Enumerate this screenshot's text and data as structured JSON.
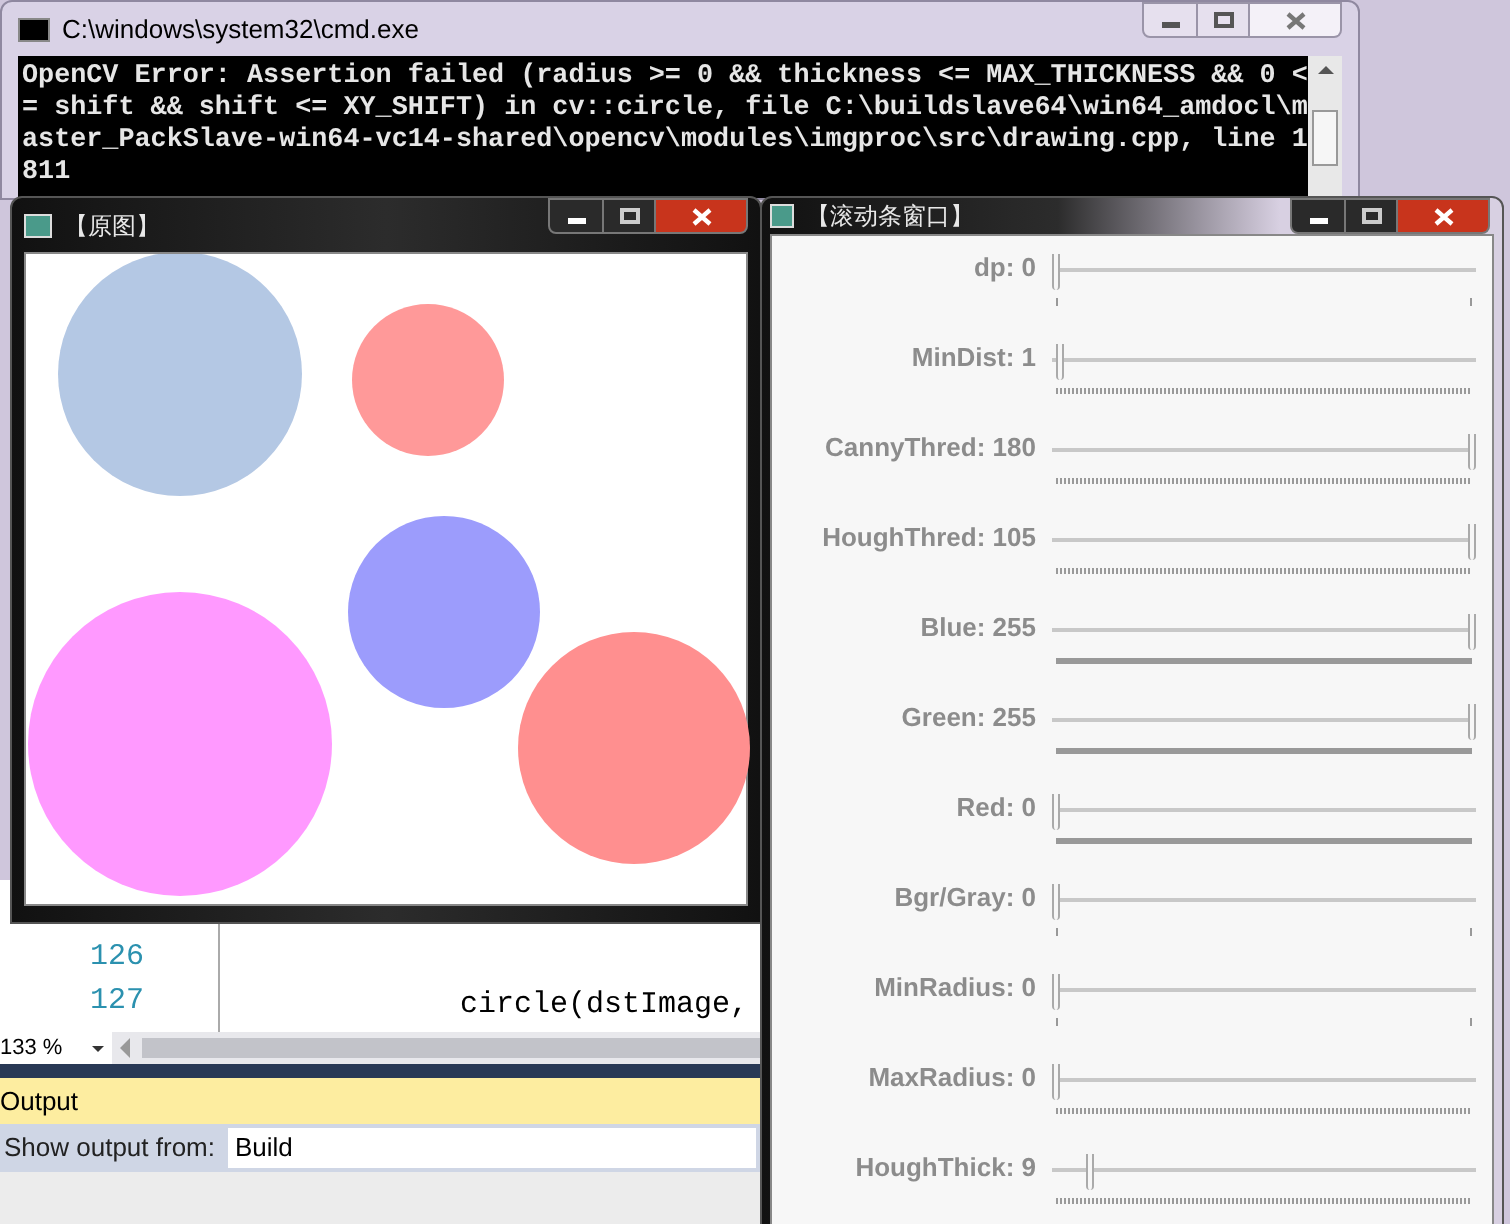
{
  "console_window": {
    "title": "C:\\windows\\system32\\cmd.exe",
    "lines": [
      "OpenCV Error: Assertion failed (radius >= 0 && thickness <= MAX_THICKNESS && 0 <",
      "= shift && shift <= XY_SHIFT) in cv::circle, file C:\\buildslave64\\win64_amdocl\\m",
      "aster_PackSlave-win64-vc14-shared\\opencv\\modules\\imgproc\\src\\drawing.cpp, line 1",
      "811"
    ]
  },
  "image_window": {
    "title": "【原图】",
    "circles": [
      {
        "color": "#b4c8e4"
      },
      {
        "color": "#ff9999"
      },
      {
        "color": "#9c9cfc"
      },
      {
        "color": "#ff99ff"
      },
      {
        "color": "#ff8f8f"
      }
    ]
  },
  "trackbar_window": {
    "title": "【滚动条窗口】",
    "trackbars": [
      {
        "label": "dp: 0",
        "level": 0,
        "kind": "ends"
      },
      {
        "label": "MinDist: 1",
        "level": 0.01,
        "kind": "dense"
      },
      {
        "label": "CannyThred: 180",
        "level": 1,
        "kind": "dense"
      },
      {
        "label": "HoughThred: 105",
        "level": 1,
        "kind": "dense"
      },
      {
        "label": "Blue: 255",
        "level": 1,
        "kind": "solid"
      },
      {
        "label": "Green: 255",
        "level": 1,
        "kind": "solid"
      },
      {
        "label": "Red: 0",
        "level": 0,
        "kind": "solid"
      },
      {
        "label": "Bgr/Gray: 0",
        "level": 0,
        "kind": "ends"
      },
      {
        "label": "MinRadius: 0",
        "level": 0,
        "kind": "ends"
      },
      {
        "label": "MaxRadius: 0",
        "level": 0,
        "kind": "dense"
      },
      {
        "label": "HoughThick: 9",
        "level": 0.08,
        "kind": "dense"
      }
    ]
  },
  "editor": {
    "lines": [
      {
        "number": "126"
      },
      {
        "number": "127",
        "code": "circle(dstImage,"
      }
    ],
    "zoom": "133 %"
  },
  "output_panel": {
    "title": "Output",
    "source_label": "Show output from:",
    "source": "Build"
  }
}
